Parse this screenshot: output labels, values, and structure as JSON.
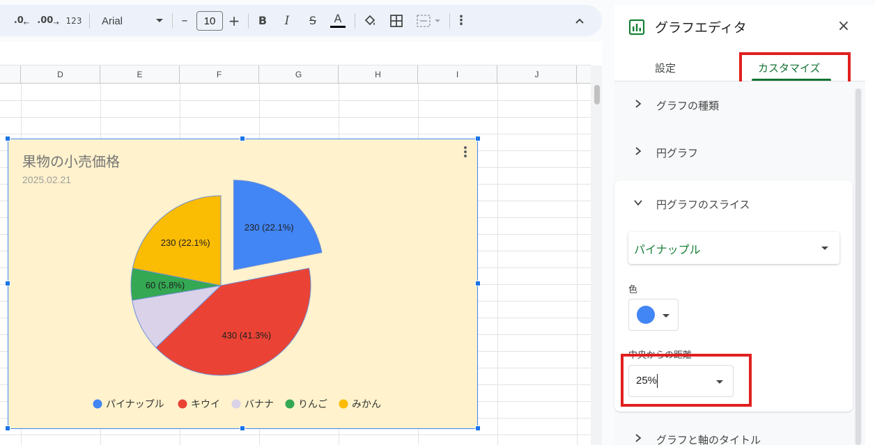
{
  "toolbar": {
    "decrease_decimal": ".0",
    "increase_decimal": ".00",
    "number_format": "123",
    "font_family": "Arial",
    "font_size": "10",
    "minus": "–",
    "plus": "+",
    "bold": "B",
    "italic": "I",
    "strikethrough": "S",
    "text_color": "A",
    "more": "⋮",
    "collapse": "⌃"
  },
  "columns": [
    "D",
    "E",
    "F",
    "G",
    "H",
    "I",
    "J"
  ],
  "chart": {
    "title": "果物の小売価格",
    "subtitle": "2025.02.21",
    "background": "#fff2cc"
  },
  "chart_data": {
    "type": "pie",
    "title": "果物の小売価格",
    "subtitle": "2025.02.21",
    "categories": [
      "パイナップル",
      "キウイ",
      "バナナ",
      "りんご",
      "みかん"
    ],
    "values": [
      230,
      430,
      100,
      60,
      230
    ],
    "percent_labels": [
      "230 (22.1%)",
      "430 (41.3%)",
      "",
      "60 (5.8%)",
      "230 (22.1%)"
    ],
    "colors": [
      "#4285f4",
      "#ea4335",
      "#d9d2e9",
      "#34a853",
      "#fbbc04"
    ],
    "exploded": [
      0.25,
      0,
      0,
      0,
      0
    ],
    "legend_position": "bottom"
  },
  "panel": {
    "title": "グラフエディタ",
    "close": "×",
    "tab_setup": "設定",
    "tab_customize": "カスタマイズ",
    "sections": {
      "chart_type": "グラフの種類",
      "pie_chart": "円グラフ",
      "pie_slice": "円グラフのスライス",
      "titles": "グラフと軸のタイトル"
    },
    "slice_select": "パイナップル",
    "color_label": "色",
    "distance_label": "中央からの距離",
    "distance_value": "25%"
  },
  "colors": {
    "accent_green": "#137333",
    "highlight_red": "#e0201f",
    "selection_blue": "#1a73e8"
  }
}
